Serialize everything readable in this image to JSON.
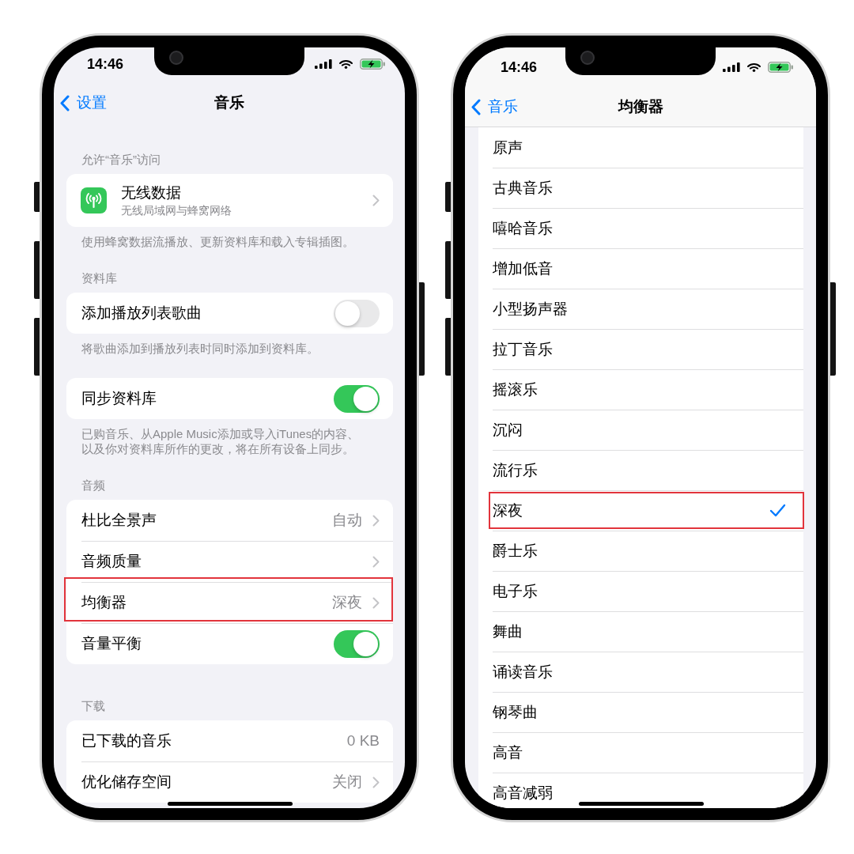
{
  "phones": [
    {
      "kind": "settings",
      "status_bar": {
        "time": "14:46"
      },
      "nav": {
        "back": "设置",
        "title": "音乐"
      },
      "sections": [
        {
          "header": "允许“音乐”访问",
          "rows": [
            {
              "kind": "icon_link",
              "title": "无线数据",
              "subtitle": "无线局域网与蜂窝网络",
              "highlighted": false
            }
          ],
          "footer": "使用蜂窝数据流播放、更新资料库和载入专辑插图。"
        },
        {
          "header": "资料库",
          "rows": [
            {
              "kind": "toggle",
              "title": "添加播放列表歌曲",
              "on": false,
              "highlighted": false
            }
          ],
          "footer": "将歌曲添加到播放列表时同时添加到资料库。"
        },
        {
          "rows": [
            {
              "kind": "toggle",
              "title": "同步资料库",
              "on": true,
              "highlighted": false
            }
          ],
          "footer": "已购音乐、从Apple Music添加或导入iTunes的内容、以及你对资料库所作的更改，将在所有设备上同步。"
        },
        {
          "header": "音频",
          "rows": [
            {
              "kind": "link",
              "title": "杜比全景声",
              "value": "自动",
              "highlighted": false
            },
            {
              "kind": "link",
              "title": "音频质量",
              "highlighted": false
            },
            {
              "kind": "link",
              "title": "均衡器",
              "value": "深夜",
              "highlighted": true
            },
            {
              "kind": "toggle",
              "title": "音量平衡",
              "on": true,
              "highlighted": false
            }
          ]
        },
        {
          "header": "下载",
          "rows": [
            {
              "kind": "value",
              "title": "已下载的音乐",
              "value": "0 KB",
              "highlighted": false
            },
            {
              "kind": "link",
              "title": "优化储存空间",
              "value": "关闭",
              "highlighted": false
            }
          ]
        }
      ]
    },
    {
      "kind": "equalizer",
      "status_bar": {
        "time": "14:46"
      },
      "nav": {
        "back": "音乐",
        "title": "均衡器"
      },
      "options": [
        {
          "label": "原声",
          "selected": false,
          "highlighted": false
        },
        {
          "label": "古典音乐",
          "selected": false,
          "highlighted": false
        },
        {
          "label": "嘻哈音乐",
          "selected": false,
          "highlighted": false
        },
        {
          "label": "增加低音",
          "selected": false,
          "highlighted": false
        },
        {
          "label": "小型扬声器",
          "selected": false,
          "highlighted": false
        },
        {
          "label": "拉丁音乐",
          "selected": false,
          "highlighted": false
        },
        {
          "label": "摇滚乐",
          "selected": false,
          "highlighted": false
        },
        {
          "label": "沉闷",
          "selected": false,
          "highlighted": false
        },
        {
          "label": "流行乐",
          "selected": false,
          "highlighted": false
        },
        {
          "label": "深夜",
          "selected": true,
          "highlighted": true
        },
        {
          "label": "爵士乐",
          "selected": false,
          "highlighted": false
        },
        {
          "label": "电子乐",
          "selected": false,
          "highlighted": false
        },
        {
          "label": "舞曲",
          "selected": false,
          "highlighted": false
        },
        {
          "label": "诵读音乐",
          "selected": false,
          "highlighted": false
        },
        {
          "label": "钢琴曲",
          "selected": false,
          "highlighted": false
        },
        {
          "label": "高音",
          "selected": false,
          "highlighted": false
        },
        {
          "label": "高音减弱",
          "selected": false,
          "highlighted": false
        }
      ]
    }
  ]
}
